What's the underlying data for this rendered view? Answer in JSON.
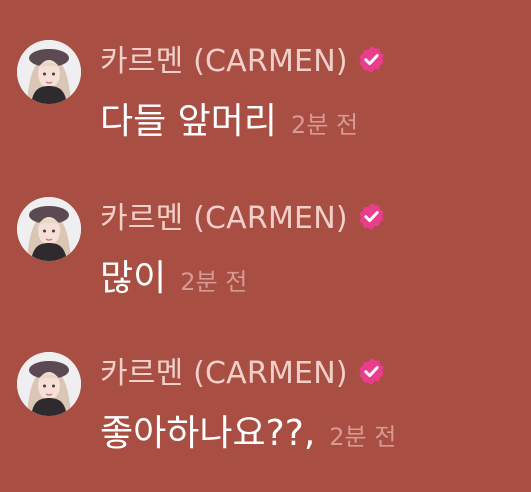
{
  "colors": {
    "background": "#a84e43",
    "author_text": "#f2cfc9",
    "message_text": "#ffffff",
    "timestamp_text": "#d69a92",
    "verified_badge": "#ea3d8c"
  },
  "messages": [
    {
      "author": "카르멘 (CARMEN)",
      "verified_icon": "verified-badge-icon",
      "text": "다들 앞머리",
      "time": "2분 전"
    },
    {
      "author": "카르멘 (CARMEN)",
      "verified_icon": "verified-badge-icon",
      "text": "많이",
      "time": "2분 전"
    },
    {
      "author": "카르멘 (CARMEN)",
      "verified_icon": "verified-badge-icon",
      "text": "좋아하나요??,",
      "time": "2분 전"
    }
  ]
}
